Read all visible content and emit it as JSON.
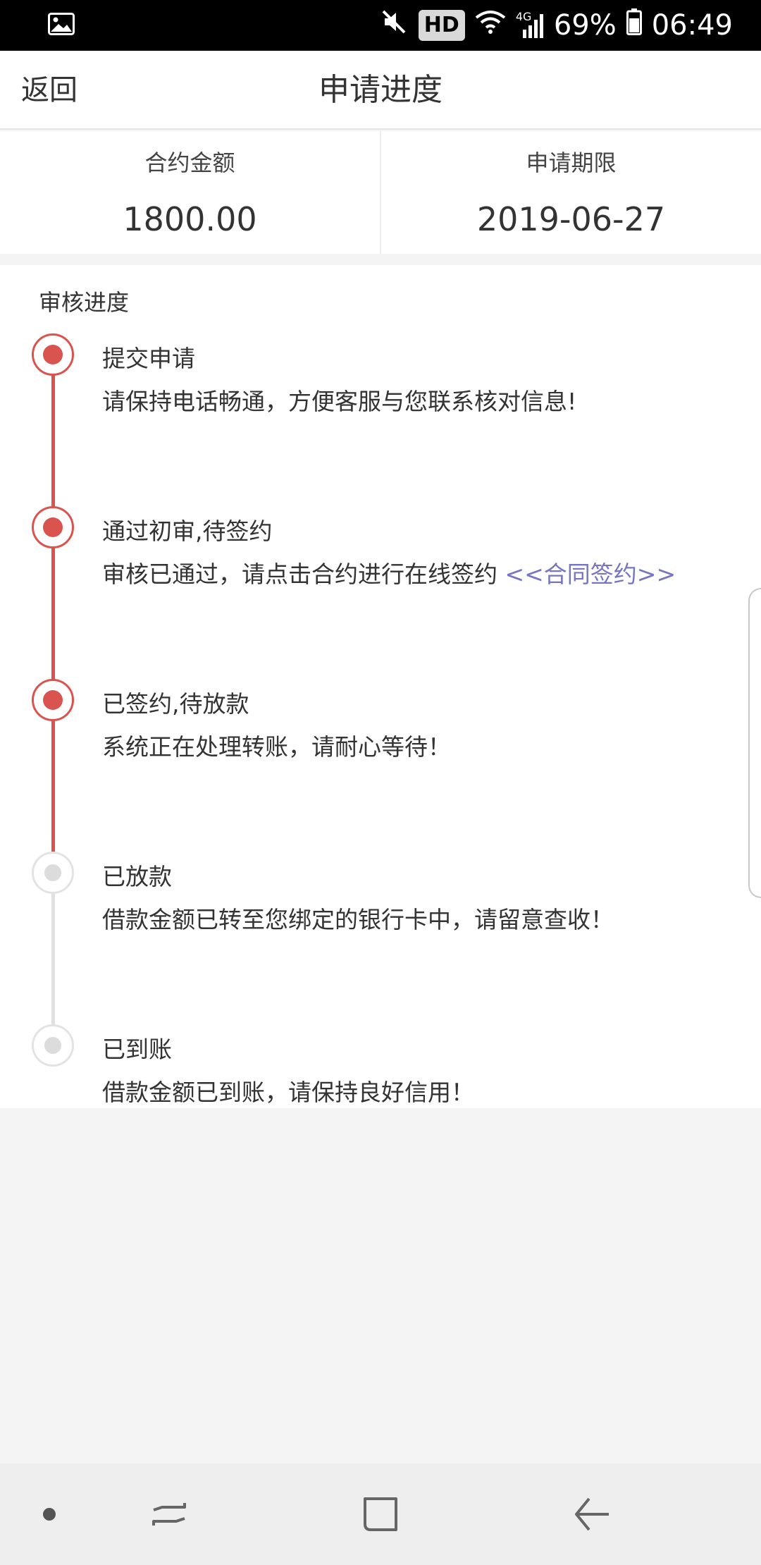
{
  "status_bar": {
    "hd": "HD",
    "network": "4G",
    "battery": "69%",
    "time": "06:49"
  },
  "header": {
    "back_label": "返回",
    "title": "申请进度"
  },
  "summary": {
    "amount_label": "合约金额",
    "amount_value": "1800.00",
    "period_label": "申请期限",
    "period_value": "2019-06-27"
  },
  "progress": {
    "section_title": "审核进度",
    "steps": [
      {
        "title": "提交申请",
        "desc": "请保持电话畅通，方便客服与您联系核对信息!",
        "status": "done"
      },
      {
        "title": "通过初审,待签约",
        "desc": "审核已通过，请点击合约进行在线签约 ",
        "link": "<<合同签约>>",
        "status": "done"
      },
      {
        "title": "已签约,待放款",
        "desc": "系统正在处理转账，请耐心等待！",
        "status": "done"
      },
      {
        "title": "已放款",
        "desc": "借款金额已转至您绑定的银行卡中，请留意查收！",
        "status": "pending"
      },
      {
        "title": "已到账",
        "desc": "借款金额已到账，请保持良好信用！",
        "status": "pending"
      }
    ]
  },
  "colors": {
    "accent": "#d9534f",
    "link": "#7575c4",
    "pending": "#dcdcdc"
  },
  "nav_bar": {
    "icons": [
      "dot-icon",
      "recent-apps-icon",
      "home-icon",
      "back-arrow-icon"
    ]
  }
}
